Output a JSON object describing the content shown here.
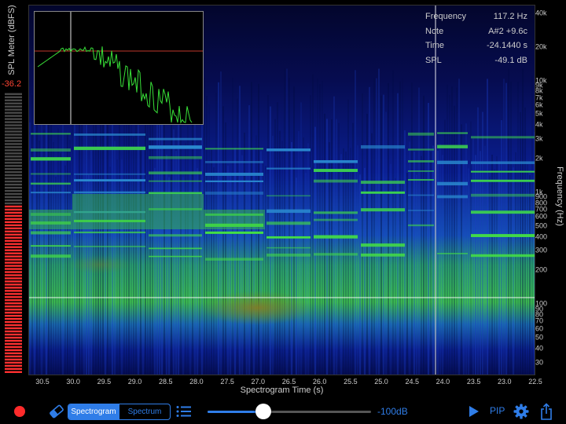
{
  "spl_meter": {
    "title": "SPL Meter (dBFS)",
    "value": "-36.2",
    "level": 0.6
  },
  "readout": [
    {
      "label": "Frequency",
      "value": "117.2 Hz"
    },
    {
      "label": "Note",
      "value": "A#2 +9.6c"
    },
    {
      "label": "Time",
      "value": "-24.1440 s"
    },
    {
      "label": "SPL",
      "value": "-49.1 dB"
    }
  ],
  "frequency_axis": {
    "title": "Frequency (Hz)",
    "ticks": [
      "40k",
      "20k",
      "10k",
      "9k",
      "8k",
      "7k",
      "6k",
      "5k",
      "4k",
      "3k",
      "2k",
      "1k",
      "900",
      "800",
      "700",
      "600",
      "500",
      "400",
      "300",
      "200",
      "100",
      "90",
      "80",
      "70",
      "60",
      "50",
      "40",
      "30"
    ],
    "tick_values": [
      40000,
      20000,
      10000,
      9000,
      8000,
      7000,
      6000,
      5000,
      4000,
      3000,
      2000,
      1000,
      900,
      800,
      700,
      600,
      500,
      400,
      300,
      200,
      100,
      90,
      80,
      70,
      60,
      50,
      40,
      30
    ]
  },
  "time_axis": {
    "title": "Spectrogram Time (s)",
    "ticks": [
      "30.5",
      "30.0",
      "29.5",
      "29.0",
      "28.5",
      "28.0",
      "27.5",
      "27.0",
      "26.5",
      "26.0",
      "25.5",
      "25.0",
      "24.5",
      "24.0",
      "23.5",
      "23.0",
      "22.5"
    ]
  },
  "toolbar": {
    "segments": [
      "Spectrogram",
      "Spectrum"
    ],
    "selected_segment": "Spectrogram",
    "slider_label": "-100dB",
    "slider_level": 0.34,
    "pip_label": "PIP"
  },
  "icons": {
    "record": "record-icon",
    "eraser": "eraser-icon",
    "list": "list-icon",
    "play": "play-icon",
    "settings": "gear-icon",
    "share": "share-icon"
  },
  "colors": {
    "accent": "#2f7de8",
    "record": "#ff2b2b",
    "spl_value": "#ff4433",
    "spectrum_line": "#38e038"
  }
}
